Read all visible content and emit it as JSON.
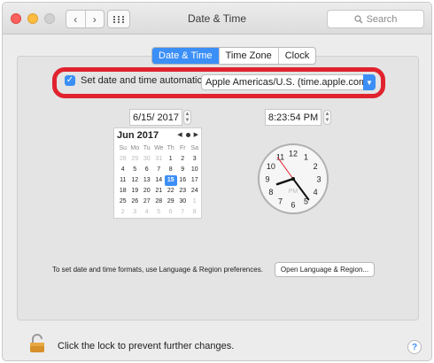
{
  "window": {
    "title": "Date & Time"
  },
  "toolbar": {
    "back_glyph": "‹",
    "forward_glyph": "›",
    "search_placeholder": "Search"
  },
  "tabs": [
    {
      "label": "Date & Time",
      "active": true
    },
    {
      "label": "Time Zone",
      "active": false
    },
    {
      "label": "Clock",
      "active": false
    }
  ],
  "auto": {
    "checked": true,
    "label": "Set date and time automatically:",
    "server": "Apple Americas/U.S. (time.apple.com.)"
  },
  "date_value": "6/15/ 2017",
  "time_value": "8:23:54 PM",
  "calendar": {
    "month_label": "Jun 2017",
    "weekdays": [
      "Su",
      "Mo",
      "Tu",
      "We",
      "Th",
      "Fr",
      "Sa"
    ],
    "days": [
      "28",
      "29",
      "30",
      "31",
      "1",
      "2",
      "3",
      "4",
      "5",
      "6",
      "7",
      "8",
      "9",
      "10",
      "11",
      "12",
      "13",
      "14",
      "15",
      "16",
      "17",
      "18",
      "19",
      "20",
      "21",
      "22",
      "23",
      "24",
      "25",
      "26",
      "27",
      "28",
      "29",
      "30",
      "1",
      "2",
      "3",
      "4",
      "5",
      "6",
      "7",
      "8"
    ],
    "selected_day": "15",
    "other_month_indices": [
      0,
      1,
      2,
      3,
      34,
      35,
      36,
      37,
      38,
      39,
      40,
      41
    ]
  },
  "clock": {
    "numbers": [
      "12",
      "1",
      "2",
      "3",
      "4",
      "5",
      "6",
      "7",
      "8",
      "9",
      "10",
      "11"
    ],
    "period": "PM",
    "hour": 8,
    "minute": 23,
    "second": 54
  },
  "footer": {
    "formats_text": "To set date and time formats, use Language & Region preferences.",
    "open_button": "Open Language & Region...",
    "lock_text": "Click the lock to prevent further changes.",
    "help_glyph": "?"
  },
  "colors": {
    "accent": "#3b8ff6",
    "highlight": "#e0232e",
    "second_hand": "#e0232e"
  }
}
